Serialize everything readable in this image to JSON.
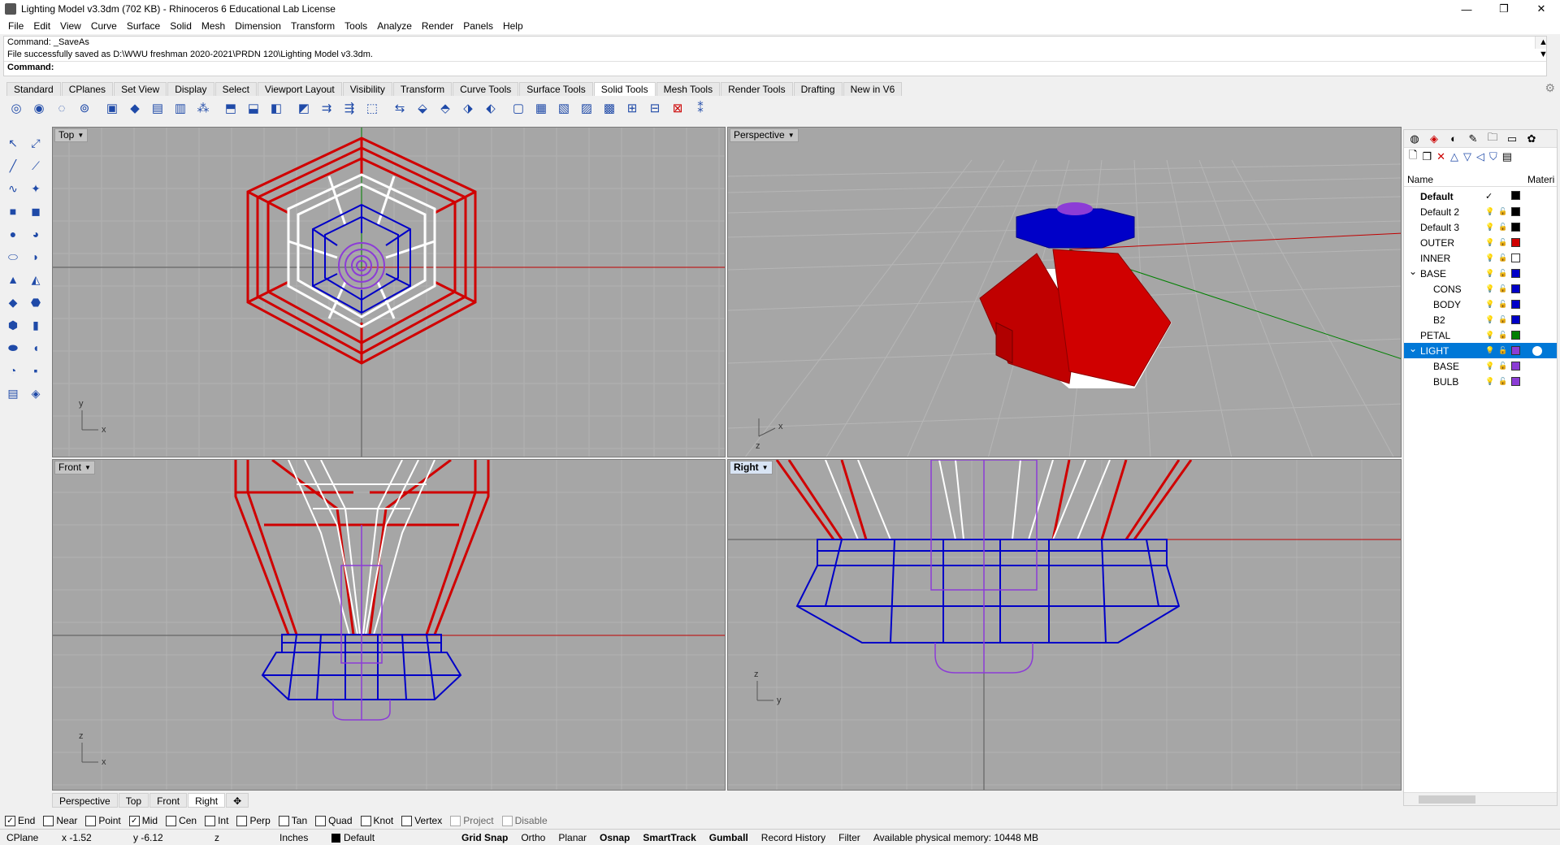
{
  "window": {
    "title": "Lighting Model v3.3dm (702 KB) - Rhinoceros 6 Educational Lab License",
    "minimize": "—",
    "maximize": "❐",
    "close": "✕"
  },
  "menu": [
    "File",
    "Edit",
    "View",
    "Curve",
    "Surface",
    "Solid",
    "Mesh",
    "Dimension",
    "Transform",
    "Tools",
    "Analyze",
    "Render",
    "Panels",
    "Help"
  ],
  "command": {
    "history": [
      "Command: _SaveAs",
      "File successfully saved as D:\\WWU freshman 2020-2021\\PRDN 120\\Lighting Model v3.3dm."
    ],
    "prompt": "Command:"
  },
  "toolbar_tabs": [
    "Standard",
    "CPlanes",
    "Set View",
    "Display",
    "Select",
    "Viewport Layout",
    "Visibility",
    "Transform",
    "Curve Tools",
    "Surface Tools",
    "Solid Tools",
    "Mesh Tools",
    "Render Tools",
    "Drafting",
    "New in V6"
  ],
  "active_toolbar_tab": "Solid Tools",
  "viewports": {
    "top": {
      "label": "Top"
    },
    "perspective": {
      "label": "Perspective"
    },
    "front": {
      "label": "Front"
    },
    "right": {
      "label": "Right"
    }
  },
  "viewport_tabs": [
    "Perspective",
    "Top",
    "Front",
    "Right"
  ],
  "active_viewport_tab": "Right",
  "layers_panel": {
    "header_name": "Name",
    "header_material": "Materi",
    "layers": [
      {
        "name": "Default",
        "current": true,
        "color": "#000000",
        "indent": 0
      },
      {
        "name": "Default 2",
        "color": "#000000",
        "indent": 0
      },
      {
        "name": "Default 3",
        "color": "#000000",
        "indent": 0
      },
      {
        "name": "OUTER",
        "color": "#d00000",
        "indent": 0
      },
      {
        "name": "INNER",
        "color": "#ffffff",
        "indent": 0
      },
      {
        "name": "BASE",
        "color": "#0000c8",
        "indent": 0,
        "expanded": true
      },
      {
        "name": "CONS",
        "color": "#0000c8",
        "indent": 1
      },
      {
        "name": "BODY",
        "color": "#0000c8",
        "indent": 1
      },
      {
        "name": "B2",
        "color": "#0000c8",
        "indent": 1
      },
      {
        "name": "PETAL",
        "color": "#008000",
        "indent": 0
      },
      {
        "name": "LIGHT",
        "color": "#8c3cd6",
        "indent": 0,
        "expanded": true,
        "selected": true
      },
      {
        "name": "BASE",
        "color": "#8c3cd6",
        "indent": 1
      },
      {
        "name": "BULB",
        "color": "#8c3cd6",
        "indent": 1
      }
    ]
  },
  "osnaps": [
    {
      "label": "End",
      "checked": true
    },
    {
      "label": "Near",
      "checked": false
    },
    {
      "label": "Point",
      "checked": false
    },
    {
      "label": "Mid",
      "checked": true
    },
    {
      "label": "Cen",
      "checked": false
    },
    {
      "label": "Int",
      "checked": false
    },
    {
      "label": "Perp",
      "checked": false
    },
    {
      "label": "Tan",
      "checked": false
    },
    {
      "label": "Quad",
      "checked": false
    },
    {
      "label": "Knot",
      "checked": false
    },
    {
      "label": "Vertex",
      "checked": false
    },
    {
      "label": "Project",
      "checked": false,
      "disabled": true
    },
    {
      "label": "Disable",
      "checked": false,
      "disabled": true
    }
  ],
  "status": {
    "cplane": "CPlane",
    "x": "x -1.52",
    "y": "y -6.12",
    "z": "z",
    "units": "Inches",
    "layer": "Default",
    "grid_snap": "Grid Snap",
    "ortho": "Ortho",
    "planar": "Planar",
    "osnap": "Osnap",
    "smarttrack": "SmartTrack",
    "gumball": "Gumball",
    "record_history": "Record History",
    "filter": "Filter",
    "memory": "Available physical memory: 10448 MB"
  },
  "axes": {
    "top_x": "x",
    "top_y": "y",
    "persp_x": "x",
    "persp_z": "z",
    "front_x": "x",
    "front_z": "z",
    "right_y": "y",
    "right_z": "z"
  }
}
